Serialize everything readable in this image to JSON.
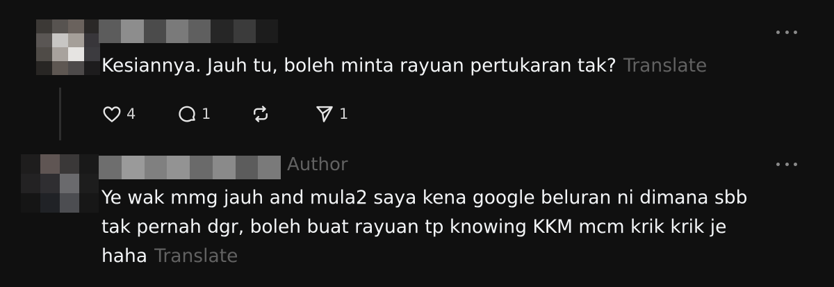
{
  "comments": [
    {
      "text": "Kesiannya. Jauh tu, boleh minta rayuan pertukaran tak?",
      "translate_label": "Translate",
      "actions": {
        "like_count": "4",
        "reply_count": "1",
        "share_count": "1"
      }
    },
    {
      "badge": "Author",
      "text_lines": [
        "Ye wak mmg jauh and mula2 saya kena google beluran ni dimana sbb",
        "tak pernah dgr, boleh buat rayuan tp knowing KKM mcm krik krik je",
        "haha"
      ],
      "translate_label": "Translate"
    }
  ],
  "icons": {
    "like": "heart-icon",
    "reply": "speech-bubble-icon",
    "repost": "repost-icon",
    "share": "send-icon",
    "more": "more-horizontal-icon"
  },
  "colors": {
    "background": "#101010",
    "text": "#f3f5f7",
    "muted": "#616161",
    "thread_line": "#2e2e2e"
  }
}
